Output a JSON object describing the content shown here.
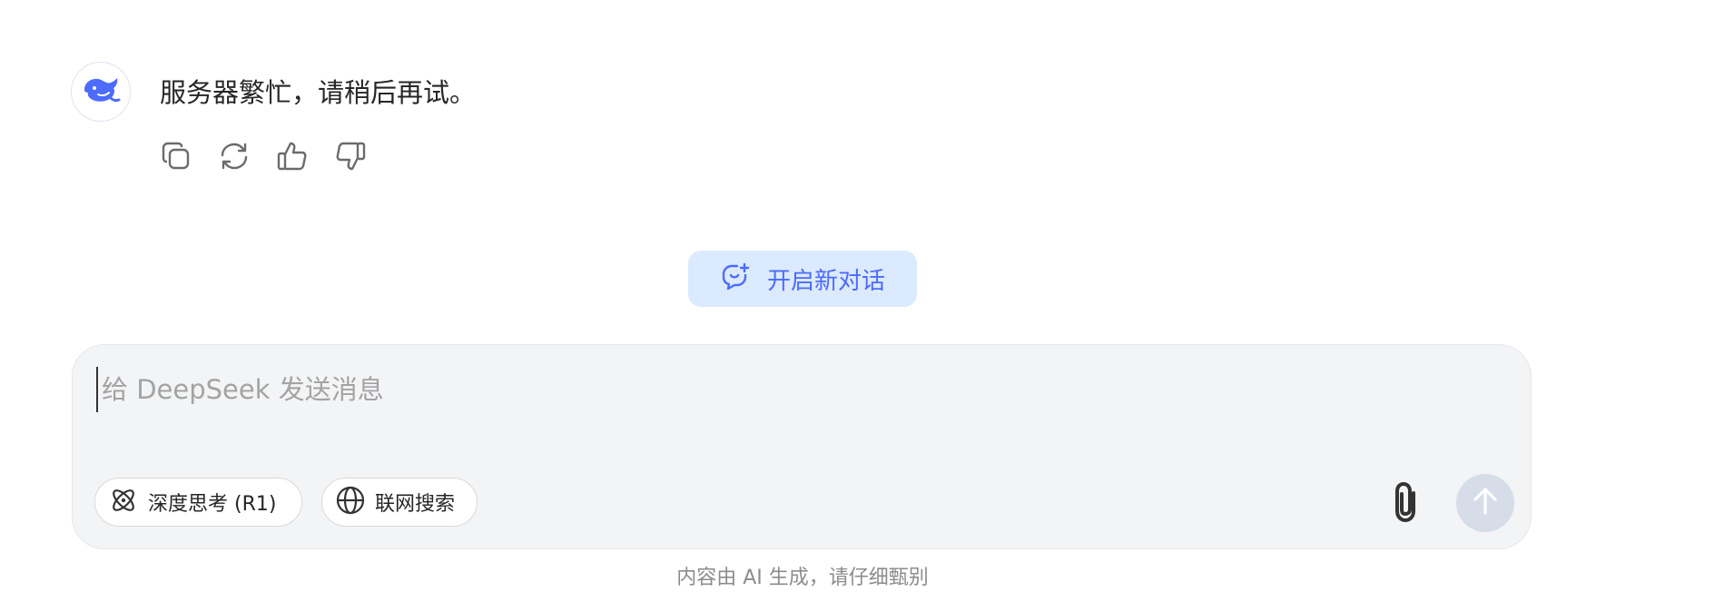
{
  "message": {
    "avatar_icon": "deepseek-whale-logo-icon",
    "text": "服务器繁忙，请稍后再试。",
    "actions": [
      {
        "name": "copy-icon"
      },
      {
        "name": "regenerate-icon"
      },
      {
        "name": "thumbs-up-icon"
      },
      {
        "name": "thumbs-down-icon"
      }
    ]
  },
  "new_chat": {
    "label": "开启新对话",
    "icon": "new-chat-bubble-icon"
  },
  "composer": {
    "placeholder": "给 DeepSeek 发送消息",
    "value": "",
    "deep_think_label": "深度思考 (R1)",
    "deep_think_icon": "atom-icon",
    "web_search_label": "联网搜索",
    "web_search_icon": "globe-icon",
    "attach_icon": "paperclip-icon",
    "send_icon": "arrow-up-icon"
  },
  "disclaimer": "内容由 AI 生成，请仔细甄别",
  "colors": {
    "accent": "#4d6bfe",
    "new_chat_bg": "#dbeafe",
    "composer_bg": "#f3f4f6",
    "send_disabled": "#d6dde9"
  }
}
